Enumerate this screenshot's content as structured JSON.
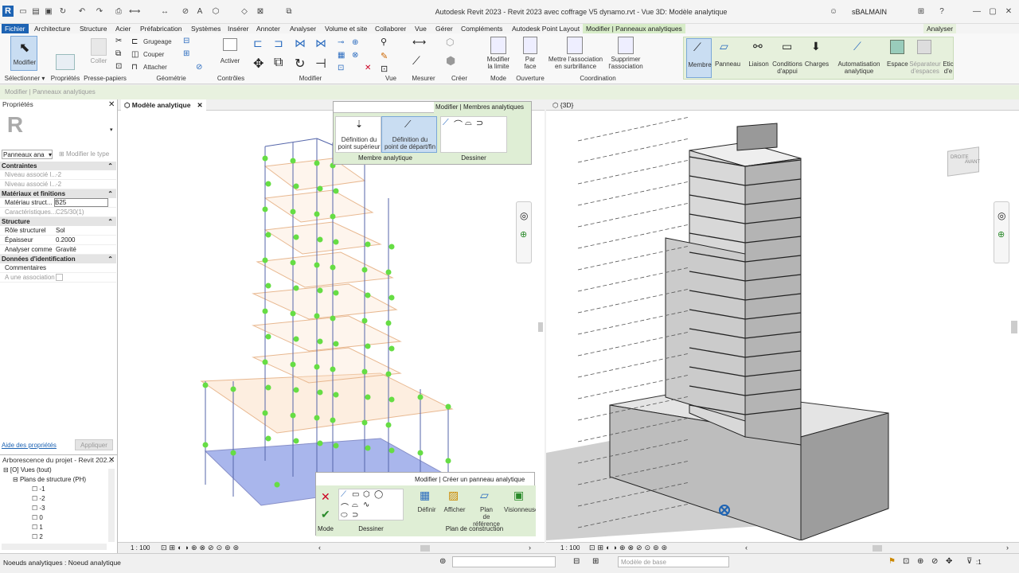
{
  "app": {
    "title": "Autodesk Revit 2023 - Revit 2023 avec coffrage V5 dynamo.rvt - Vue 3D: Modèle analytique",
    "logo": "R",
    "user": "sBALMAIN"
  },
  "menu": {
    "tabs": [
      "Fichier",
      "Architecture",
      "Structure",
      "Acier",
      "Préfabrication",
      "Systèmes",
      "Insérer",
      "Annoter",
      "Analyser",
      "Volume et site",
      "Collaborer",
      "Vue",
      "Gérer",
      "Compléments",
      "Autodesk Point Layout",
      "Modifier | Panneaux analytiques"
    ],
    "analyser_tab": "Analyser"
  },
  "ribbon": {
    "modifier": "Modifier",
    "coller": "Coller",
    "grugeage": "Grugeage",
    "couper": "Couper",
    "attacher": "Attacher",
    "activer": "Activer",
    "modifier_limite": "Modifier\nla limite",
    "par_face": "Par\nface",
    "mettre_association": "Mettre l'association\nen surbrillance",
    "supprimer_association": "Supprimer\nl'association",
    "membre": "Membre",
    "panneau": "Panneau",
    "liaison": "Liaison",
    "conditions": "Conditions\nd'appui",
    "charges": "Charges",
    "automatisation": "Automatisation\nanalytique",
    "espace": "Espace",
    "separateur": "Séparateur\nd'espaces",
    "etic": "Etic\nd'e",
    "groups": {
      "selectionner": "Sélectionner ▾",
      "proprietes": "Propriétés",
      "presse": "Presse-papiers",
      "geometrie": "Géométrie",
      "controles": "Contrôles",
      "modifier": "Modifier",
      "vue": "Vue",
      "mesurer": "Mesurer",
      "creer": "Créer",
      "mode": "Mode",
      "ouverture": "Ouverture",
      "coordination": "Coordination"
    }
  },
  "modline": "Modifier | Panneaux analytiques",
  "properties": {
    "title": "Propriétés",
    "type_select": "Panneaux ana",
    "modify_type": "Modifier le type",
    "sections": {
      "contraintes": "Contraintes",
      "materiaux": "Matériaux et finitions",
      "structure": "Structure",
      "donnees": "Données d'identification"
    },
    "rows": {
      "niveau1_k": "Niveau associé l...",
      "niveau1_v": "-2",
      "niveau2_k": "Niveau associé l...",
      "niveau2_v": "-2",
      "materiau_k": "Matériau struct...",
      "materiau_v": "B25",
      "caract_k": "Caractéristiques...",
      "caract_v": "C25/30(1)",
      "role_k": "Rôle structurel",
      "role_v": "Sol",
      "epaisseur_k": "Épaisseur",
      "epaisseur_v": "0.2000",
      "analyser_k": "Analyser comme",
      "analyser_v": "Gravité",
      "comment_k": "Commentaires",
      "assoc_k": "A une association"
    },
    "help_link": "Aide des propriétés",
    "apply": "Appliquer"
  },
  "browser": {
    "title": "Arborescence du projet - Revit 202...",
    "vues": "Vues (tout)",
    "plans": "Plans de structure (PH)",
    "levels": [
      "-1",
      "-2",
      "-3",
      "0",
      "1",
      "2"
    ]
  },
  "viewL": {
    "tab": "Modèle analytique",
    "ctx_title": "Modifier | Membres analytiques",
    "def_sup": "Définition du\npoint supérieur",
    "def_dep": "Définition du\npoint de départ/fin",
    "grp_membre": "Membre analytique",
    "grp_dessiner": "Dessiner",
    "panel_title": "Modifier | Créer un panneau analytique",
    "definir": "Définir",
    "afficher": "Afficher",
    "plan_ref": "Plan\nde référence",
    "visionneuse": "Visionneuse",
    "mode": "Mode",
    "dessiner": "Dessiner",
    "plan_constr": "Plan de construction",
    "scale": "1 : 100"
  },
  "viewR": {
    "tab": "{3D}",
    "cube_top": "DROITE",
    "cube_front": "AVANT",
    "scale": "1 : 100"
  },
  "status": {
    "left": "Noeuds analytiques : Noeud analytique",
    "model": "Modèle de base",
    "filter": ":1"
  },
  "colors": {
    "accent": "#1d63b3",
    "context": "#d7ecc8",
    "node": "#66dd44"
  }
}
